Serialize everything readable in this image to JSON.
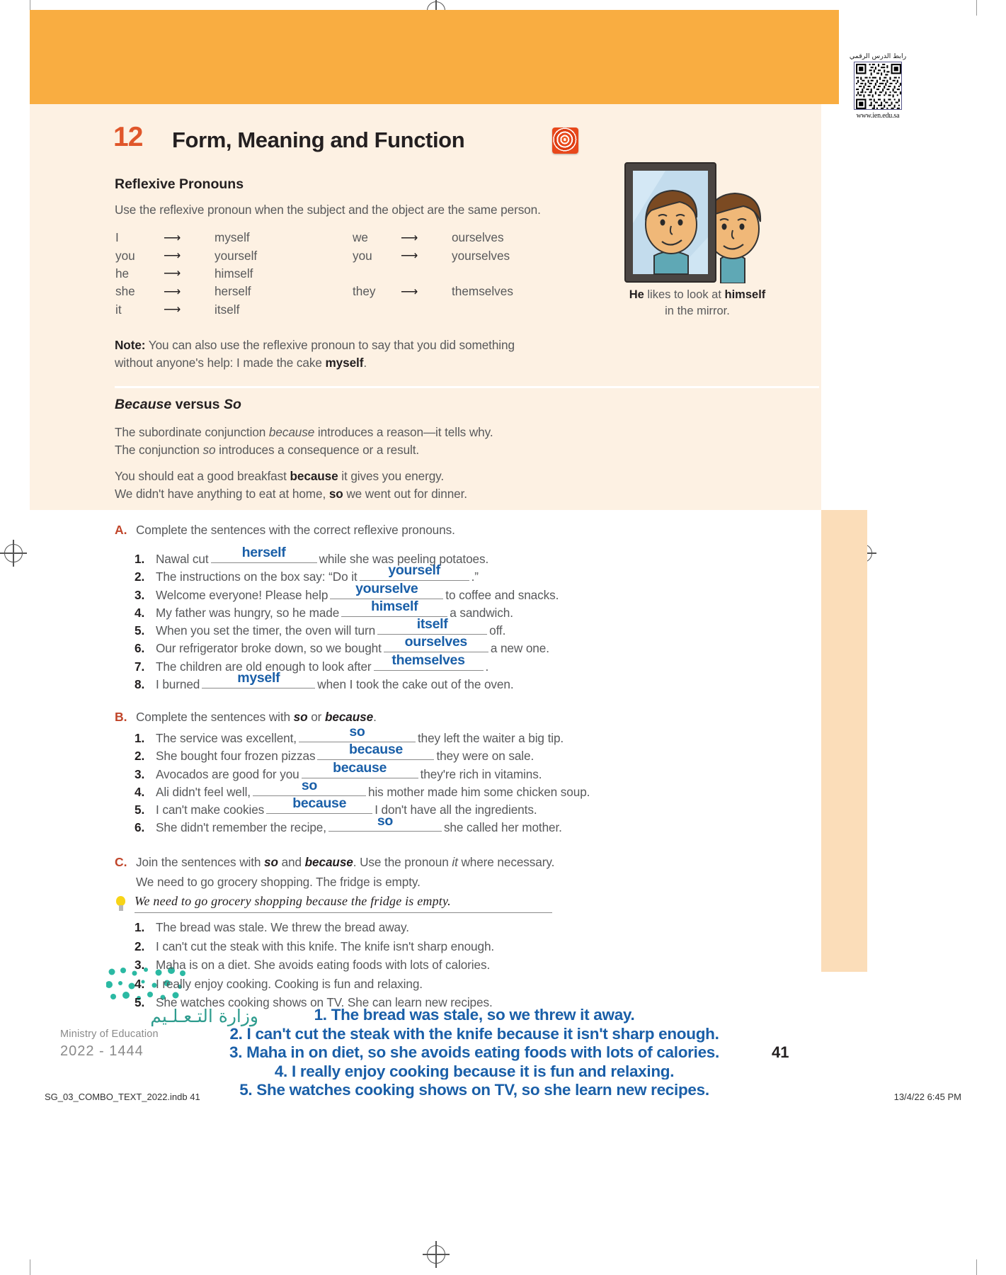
{
  "qr": {
    "arabic_label": "رابط الدرس الرقمي",
    "url": "www.ien.edu.sa"
  },
  "header": {
    "unit_number": "12",
    "title": "Form, Meaning and Function",
    "icon": "spiral-icon"
  },
  "reflexive": {
    "heading": "Reflexive Pronouns",
    "intro": "Use the reflexive pronoun when the subject and the object are the same person.",
    "left_rows": [
      {
        "subject": "I",
        "arrow": "⟶",
        "reflexive": "myself"
      },
      {
        "subject": "you",
        "arrow": "⟶",
        "reflexive": "yourself"
      },
      {
        "subject": "he",
        "arrow": "⟶",
        "reflexive": "himself"
      },
      {
        "subject": "she",
        "arrow": "⟶",
        "reflexive": "herself"
      },
      {
        "subject": "it",
        "arrow": "⟶",
        "reflexive": "itself"
      }
    ],
    "right_rows": [
      {
        "subject": "we",
        "arrow": "⟶",
        "reflexive": "ourselves"
      },
      {
        "subject": "you",
        "arrow": "⟶",
        "reflexive": "yourselves"
      },
      {
        "subject": "",
        "arrow": "",
        "reflexive": ""
      },
      {
        "subject": "they",
        "arrow": "⟶",
        "reflexive": "themselves"
      },
      {
        "subject": "",
        "arrow": "",
        "reflexive": ""
      }
    ],
    "note_label": "Note:",
    "note_line1": "You can also use the reflexive pronoun to say that you did something",
    "note_line2_a": "without anyone's help: I made the cake ",
    "note_line2_b": "myself",
    "note_line2_c": "."
  },
  "illustration": {
    "caption_a": "He",
    "caption_b": " likes to look at ",
    "caption_c": "himself",
    "caption_line2": "in the mirror."
  },
  "because_so": {
    "heading_a": "Because",
    "heading_b": " versus ",
    "heading_c": "So",
    "para1_a": "The subordinate conjunction ",
    "para1_b": "because",
    "para1_c": " introduces a reason—it tells why.",
    "para2_a": "The conjunction ",
    "para2_b": "so",
    "para2_c": " introduces a consequence or a result.",
    "ex1_a": "You should eat a good breakfast ",
    "ex1_b": "because",
    "ex1_c": " it gives you energy.",
    "ex2_a": "We didn't have anything to eat at home, ",
    "ex2_b": "so",
    "ex2_c": " we went out for dinner."
  },
  "exercise_a": {
    "letter": "A.",
    "prompt": "Complete the sentences with the correct reflexive pronouns.",
    "items": [
      {
        "num": "1.",
        "before": "Nawal cut ",
        "answer": "herself",
        "after": " while she was peeling potatoes.",
        "blank_width": 150
      },
      {
        "num": "2.",
        "before": "The instructions on the box say: “Do it ",
        "answer": "yourself",
        "after": ".”",
        "blank_width": 155
      },
      {
        "num": "3.",
        "before": "Welcome everyone! Please help ",
        "answer": "yourselve",
        "after": " to coffee and snacks.",
        "blank_width": 160
      },
      {
        "num": "4.",
        "before": "My father was hungry, so he made ",
        "answer": "himself",
        "after": " a sandwich.",
        "blank_width": 150
      },
      {
        "num": "5.",
        "before": "When you set the timer, the oven will turn ",
        "answer": "itself",
        "after": " off.",
        "blank_width": 155
      },
      {
        "num": "6.",
        "before": "Our refrigerator broke down, so we bought ",
        "answer": "ourselves",
        "after": " a new one.",
        "blank_width": 148
      },
      {
        "num": "7.",
        "before": "The children are old enough to look after ",
        "answer": "themselves",
        "after": ".",
        "blank_width": 155
      },
      {
        "num": "8.",
        "before": "I burned ",
        "answer": "myself",
        "after": " when I took the cake out of the oven.",
        "blank_width": 160
      }
    ]
  },
  "exercise_b": {
    "letter": "B.",
    "prompt_a": "Complete the sentences with ",
    "prompt_b": "so",
    "prompt_c": " or ",
    "prompt_d": "because",
    "prompt_e": ".",
    "items": [
      {
        "num": "1.",
        "before": "The service was excellent, ",
        "answer": "so",
        "after": " they left the waiter a big tip.",
        "blank_width": 165
      },
      {
        "num": "2.",
        "before": "She bought four frozen pizzas ",
        "answer": "because",
        "after": " they were on sale.",
        "blank_width": 165
      },
      {
        "num": "3.",
        "before": "Avocados are good for you ",
        "answer": "because",
        "after": " they're rich in vitamins.",
        "blank_width": 165
      },
      {
        "num": "4.",
        "before": "Ali didn't feel well, ",
        "answer": "so",
        "after": " his mother made him some chicken soup.",
        "blank_width": 160
      },
      {
        "num": "5.",
        "before": "I can't make cookies ",
        "answer": "because",
        "after": " I don't have all the ingredients.",
        "blank_width": 150
      },
      {
        "num": "6.",
        "before": "She didn't remember the recipe, ",
        "answer": "so",
        "after": " she called her mother.",
        "blank_width": 160
      }
    ]
  },
  "exercise_c": {
    "letter": "C.",
    "prompt_a": "Join the sentences with ",
    "prompt_b": "so",
    "prompt_c": " and ",
    "prompt_d": "because",
    "prompt_e": ". Use the pronoun ",
    "prompt_f": "it",
    "prompt_g": " where necessary.",
    "prompt_line2": "We need to go grocery shopping. The fridge is empty.",
    "example": "We need to go grocery shopping because the fridge is empty.",
    "items": [
      {
        "num": "1.",
        "text": "The bread was stale. We threw the bread away."
      },
      {
        "num": "2.",
        "text": "I can't cut the steak with this knife. The knife isn't sharp enough."
      },
      {
        "num": "3.",
        "text": "Maha is on a diet. She avoids eating foods with lots of calories."
      },
      {
        "num": "4.",
        "text": "I really enjoy cooking. Cooking is fun and relaxing."
      },
      {
        "num": "5.",
        "text": "She watches cooking shows on TV. She can learn new recipes."
      }
    ]
  },
  "student_answers": {
    "color": "#1a5fa8",
    "lines": [
      "1. The bread was stale, so we threw it away.",
      "2. I can't cut the steak with the knife because it isn't sharp enough.",
      "3. Maha in on diet, so she avoids eating foods with lots of calories.",
      "4. I really enjoy cooking because it is fun and relaxing.",
      "5. She watches cooking shows on TV, so she learn new recipes."
    ]
  },
  "footer": {
    "moe_arabic": "وزارة التـعـلـيم",
    "moe_english": "Ministry of Education",
    "moe_years": "2022 - 1444",
    "page_number": "41",
    "file_name": "SG_03_COMBO_TEXT_2022.indb   41",
    "print_stamp": "13/4/22   6:45 PM"
  }
}
